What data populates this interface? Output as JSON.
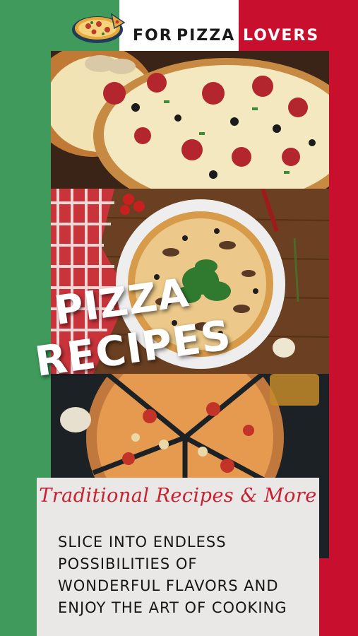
{
  "header": {
    "word_for": "FOR",
    "word_pizza": "PIZZA",
    "word_lovers": "LOVERS"
  },
  "flag_colors": {
    "green": "#3f9a5c",
    "white": "#ffffff",
    "red": "#c8102e"
  },
  "title": {
    "line1": "PIZZA",
    "line2": "RECIPES"
  },
  "tagline": "Traditional Recipes & More",
  "body_lines": [
    "SLICE INTO ENDLESS",
    "POSSIBILITIES OF",
    "WONDERFUL FLAVORS AND",
    "ENJOY THE ART OF COOKING"
  ],
  "icons": {
    "logo": "pizza-slice-logo-icon"
  }
}
